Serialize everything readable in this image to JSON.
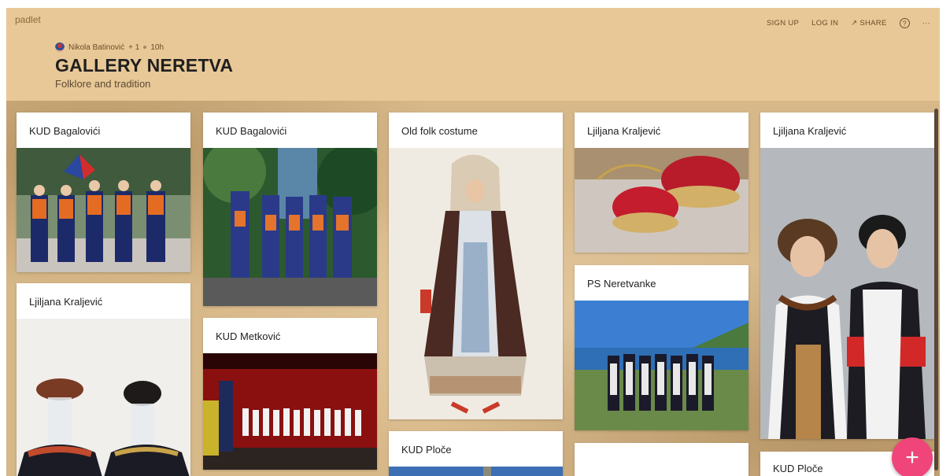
{
  "app": {
    "brand": "padlet"
  },
  "header": {
    "author": "Nikola Batinović",
    "contributors": "+ 1",
    "time": "10h",
    "title": "GALLERY NERETVA",
    "subtitle": "Folklore and tradition",
    "actions": {
      "signup": "SIGN UP",
      "login": "LOG IN",
      "share": "↗ SHARE",
      "help": "?",
      "more": "···"
    }
  },
  "cards": [
    {
      "title": "KUD Bagalovići",
      "image": "folk-dancers-photo"
    },
    {
      "title": "KUD Bagalovići",
      "image": "stage-musicians-photo"
    },
    {
      "title": "Old folk costume",
      "image": "costume-painting"
    },
    {
      "title": "Ljiljana Kraljević",
      "image": "red-cap-photo"
    },
    {
      "title": "Ljiljana Kraljević",
      "image": "costumed-dolls-photo"
    },
    {
      "title": "Ljiljana Kraljević",
      "image": "costume-doll-heads-photo"
    },
    {
      "title": "KUD Metković",
      "image": "stage-choir-photo"
    },
    {
      "title": "PS Neretvanke",
      "image": "harbor-group-photo"
    },
    {
      "title": "KUD Ploče",
      "image": "sky-photo"
    },
    {
      "title": "",
      "image": ""
    },
    {
      "title": "KUD Ploče",
      "image": ""
    }
  ],
  "fab": {
    "label": "+"
  }
}
